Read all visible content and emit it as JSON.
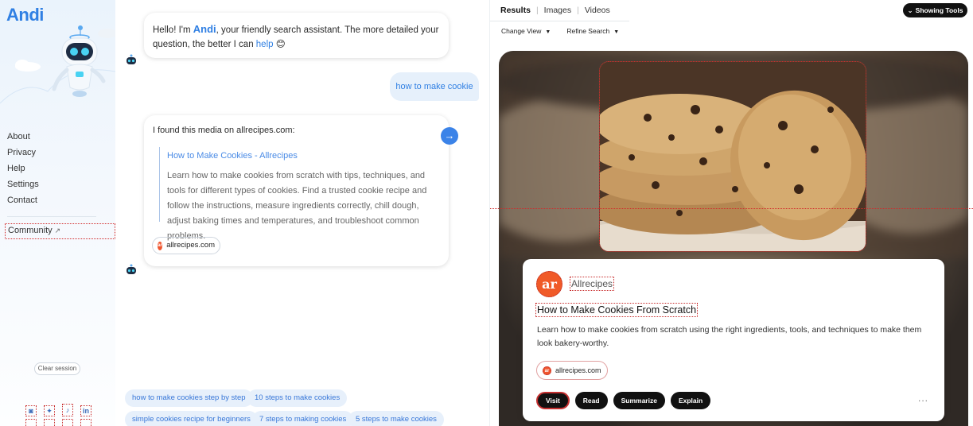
{
  "sidebar": {
    "logo": "Andi",
    "nav": [
      "About",
      "Privacy",
      "Help",
      "Settings",
      "Contact"
    ],
    "community": "Community",
    "clear_session": "Clear session",
    "social_icons": [
      "discord-icon",
      "twitter-icon",
      "tiktok-icon",
      "linkedin-icon"
    ]
  },
  "chat": {
    "greeting": {
      "prefix": "Hello! I'm ",
      "name": "Andi",
      "middle": ", your friendly search assistant. The more detailed your question, the better I can ",
      "link": "help",
      "emoji": "😊"
    },
    "user_query": "how to make cookie",
    "media_intro": "I found this media on allrecipes.com:",
    "media_title": "How to Make Cookies - Allrecipes",
    "media_desc": "Learn how to make cookies from scratch with tips, techniques, and tools for different types of cookies. Find a trusted cookie recipe and follow the instructions, measure ingredients correctly, chill dough, adjust baking times and temperatures, and troubleshoot common problems.",
    "source": "allrecipes.com",
    "suggestions": [
      "how to make cookies step by step",
      "10 steps to make cookies",
      "simple cookies recipe for beginners",
      "7 steps to making cookies",
      "5 steps to make cookies"
    ]
  },
  "results": {
    "tabs": [
      "Results",
      "Images",
      "Videos"
    ],
    "showing_tools": "Showing Tools",
    "change_view": "Change View",
    "refine_search": "Refine Search",
    "card": {
      "logo_letters": "ar",
      "site_name": "Allrecipes",
      "title": "How to Make Cookies From Scratch",
      "desc": "Learn how to make cookies from scratch using the right ingredients, tools, and techniques to make them look bakery-worthy.",
      "source": "allrecipes.com",
      "buttons": [
        "Visit",
        "Read",
        "Summarize",
        "Explain"
      ],
      "more": "..."
    }
  },
  "colors": {
    "accent": "#2f7fe3",
    "brand_orange": "#f05a28"
  }
}
